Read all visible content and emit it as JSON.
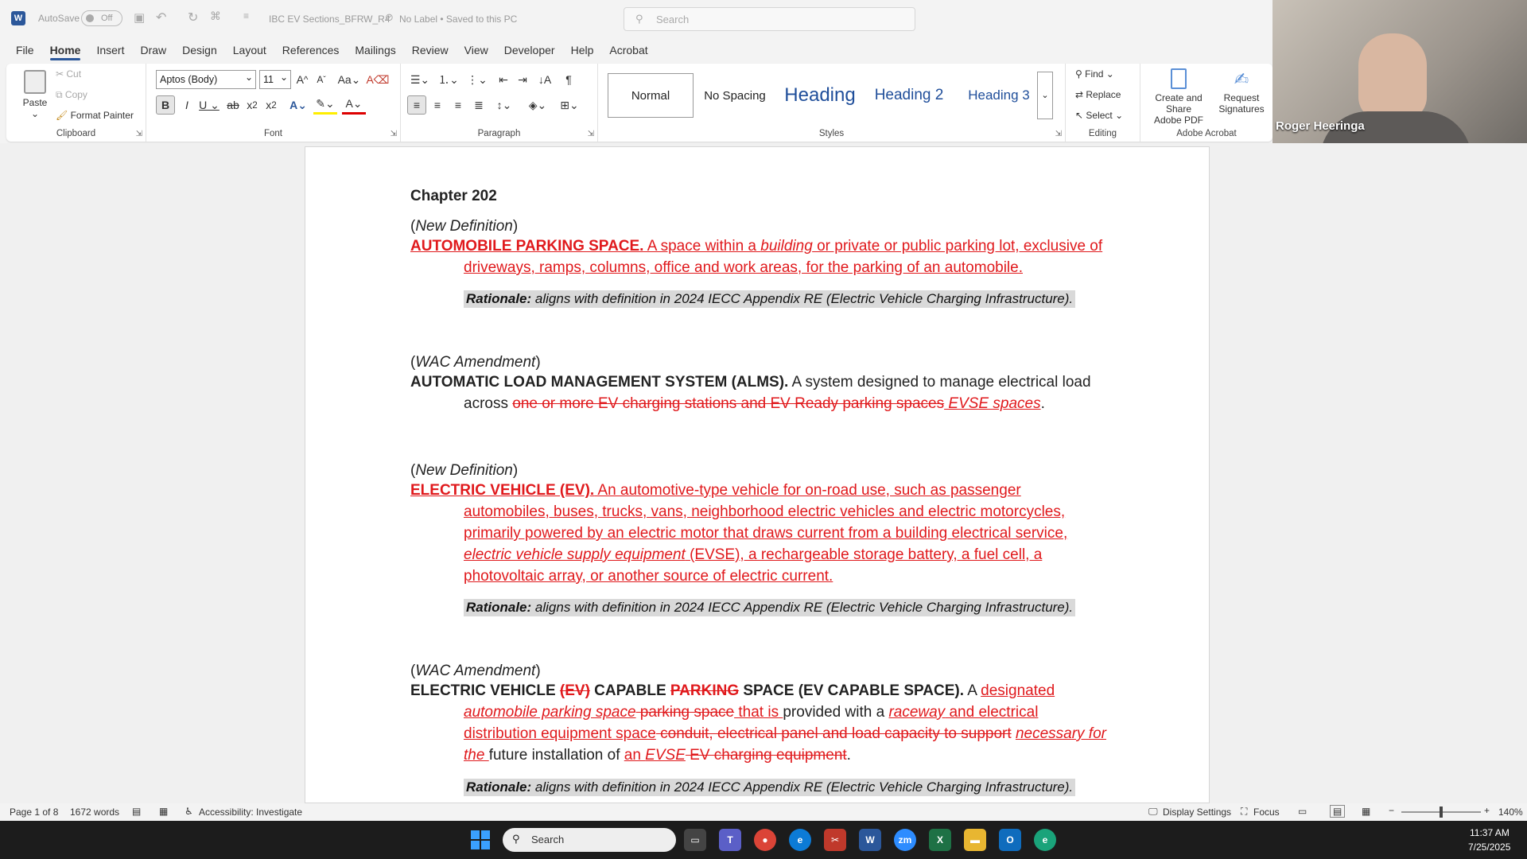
{
  "titlebar": {
    "autosave_label": "AutoSave",
    "autosave_state": "Off",
    "doc_title": "IBC EV Sections_BFRW_R4",
    "label_status": "No Label • Saved to this PC",
    "search_placeholder": "Search"
  },
  "tabs": [
    "File",
    "Home",
    "Insert",
    "Draw",
    "Design",
    "Layout",
    "References",
    "Mailings",
    "Review",
    "View",
    "Developer",
    "Help",
    "Acrobat"
  ],
  "ribbon": {
    "clipboard": {
      "paste": "Paste",
      "cut": "Cut",
      "copy": "Copy",
      "format_painter": "Format Painter",
      "label": "Clipboard"
    },
    "font": {
      "font_name": "Aptos (Body)",
      "font_size": "11",
      "label": "Font"
    },
    "paragraph": {
      "label": "Paragraph"
    },
    "styles": {
      "normal": "Normal",
      "no_spacing": "No Spacing",
      "heading": "Heading",
      "heading2": "Heading 2",
      "heading3": "Heading 3",
      "label": "Styles"
    },
    "editing": {
      "find": "Find",
      "replace": "Replace",
      "select": "Select",
      "label": "Editing"
    },
    "acrobat": {
      "create": "Create and Share",
      "create2": "Adobe PDF",
      "request": "Request",
      "request2": "Signatures",
      "label": "Adobe Acrobat"
    }
  },
  "video": {
    "participant_name": "Roger Heeringa"
  },
  "document": {
    "chapter": "Chapter 202",
    "p1_tag": "New Definition",
    "p1_term": "AUTOMOBILE PARKING SPACE.",
    "p1_a": " A space within a ",
    "p1_building": "building",
    "p1_b": " or private or public parking lot, exclusive of driveways, ramps, columns, office and work areas, for the parking of an automobile.",
    "rationale_label": "Rationale:",
    "rationale_text": " aligns with definition in 2024 IECC Appendix RE (Electric Vehicle Charging Infrastructure).",
    "p2_tag": "WAC Amendment",
    "p2_term": "AUTOMATIC LOAD MANAGEMENT SYSTEM (ALMS).",
    "p2_a": " A system designed to manage electrical load across ",
    "p2_strike": "one or more EV charging stations and EV Ready parking spaces",
    "p2_ins": " EVSE spaces",
    "p2_end": ".",
    "p3_tag": "New Definition",
    "p3_term": "ELECTRIC VEHICLE (EV).",
    "p3_a": " An automotive-type vehicle for on-road use, such as passenger automobiles, buses, trucks, vans, neighborhood electric vehicles and electric motorcycles, primarily powered by an electric motor that draws current from a building electrical service, ",
    "p3_evse": "electric vehicle supply equipment",
    "p3_b": " (EVSE), a rechargeable storage battery, a fuel cell, a photovoltaic array, or another source of electric current.",
    "p4_tag": "WAC Amendment",
    "p4_t1": "ELECTRIC VEHICLE ",
    "p4_t1s": "(EV)",
    "p4_t2": " CAPABLE ",
    "p4_t2s": "PARKING",
    "p4_t3": " SPACE (EV CAPABLE SPACE).",
    "p4_a": " A ",
    "p4_designated": "designated",
    "p4_aps": "automobile parking space",
    "p4_ps": " parking space",
    "p4_thatis": " that is ",
    "p4_prov": "provided with a ",
    "p4_raceway": "raceway",
    "p4_and": " and electrical distribution equipment space",
    "p4_strike2": " conduit, electrical panel and load capacity to support",
    "p4_nec": "necessary for the ",
    "p4_future": "future installation of ",
    "p4_an": "an ",
    "p4_evse": "EVSE",
    "p4_strike3": " EV charging equipment",
    "p4_end": "."
  },
  "status": {
    "page": "Page 1 of 8",
    "words": "1672 words",
    "accessibility": "Accessibility: Investigate",
    "display": "Display Settings",
    "focus": "Focus",
    "zoom": "140%"
  },
  "taskbar": {
    "search": "Search",
    "time": "11:37 AM",
    "date": "7/25/2025"
  },
  "colors": {
    "accent": "#2b579a",
    "revision_red": "#e0191c"
  }
}
